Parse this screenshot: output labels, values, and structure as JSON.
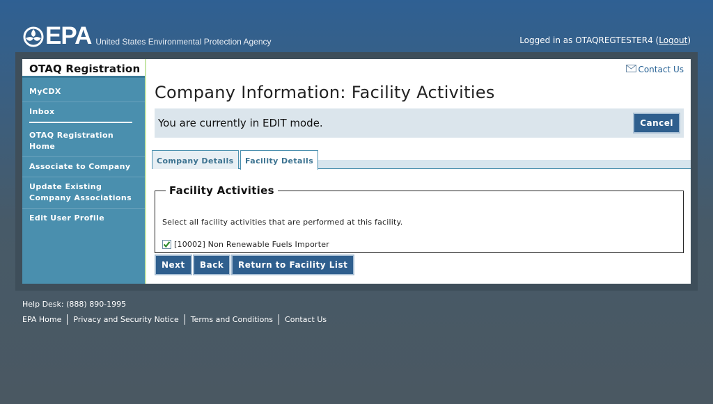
{
  "header": {
    "logo_text": "EPA",
    "agency_name": "United States Environmental Protection Agency",
    "login_prefix": "Logged in as OTAQREGTESTER4 (",
    "logout_label": "Logout",
    "login_suffix": ")"
  },
  "sidebar": {
    "app_title": "OTAQ Registration",
    "items": [
      {
        "label": "MyCDX"
      },
      {
        "label": "Inbox"
      },
      {
        "label": "OTAQ Registration Home"
      },
      {
        "label": "Associate to Company"
      },
      {
        "label": "Update Existing Company Associations"
      },
      {
        "label": "Edit User Profile"
      }
    ]
  },
  "main": {
    "contact_us": "Contact Us",
    "page_title": "Company Information: Facility Activities",
    "edit_mode_text": "You are currently in EDIT mode.",
    "cancel_label": "Cancel",
    "tabs": [
      {
        "label": "Company Details",
        "active": false
      },
      {
        "label": "Facility Details",
        "active": true
      }
    ],
    "fieldset_legend": "Facility Activities",
    "instructions": "Select all facility activities that are performed at this facility.",
    "activities": [
      {
        "label": "[10002] Non Renewable Fuels Importer",
        "checked": true
      }
    ],
    "buttons": {
      "next": "Next",
      "back": "Back",
      "return": "Return to Facility List"
    }
  },
  "footer": {
    "helpdesk": "Help Desk: (888) 890-1995",
    "links": [
      "EPA Home",
      "Privacy and Security Notice",
      "Terms and Conditions",
      "Contact Us"
    ]
  },
  "colors": {
    "sidebar_bg": "#4a8fae",
    "button_bg": "#2f5f8e",
    "banner_bg": "#dbe5ec",
    "link": "#2a6496"
  }
}
